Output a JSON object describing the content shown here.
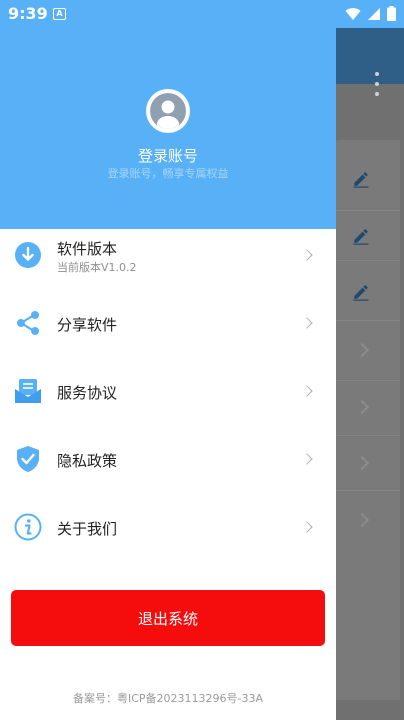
{
  "status_bar": {
    "time": "9:39",
    "notification": "A"
  },
  "header": {
    "login_title": "登录账号",
    "login_subtitle": "登录账号，畅享专属权益"
  },
  "menu": [
    {
      "label": "软件版本",
      "sublabel": "当前版本V1.0.2",
      "icon": "download-icon"
    },
    {
      "label": "分享软件",
      "icon": "share-icon"
    },
    {
      "label": "服务协议",
      "icon": "agreement-icon"
    },
    {
      "label": "隐私政策",
      "icon": "shield-check-icon"
    },
    {
      "label": "关于我们",
      "icon": "info-icon"
    }
  ],
  "logout_label": "退出系统",
  "icp_text": "备案号：粤ICP备2023113296号-33A",
  "colors": {
    "primary": "#58b1f7",
    "danger": "#f50d0d"
  }
}
